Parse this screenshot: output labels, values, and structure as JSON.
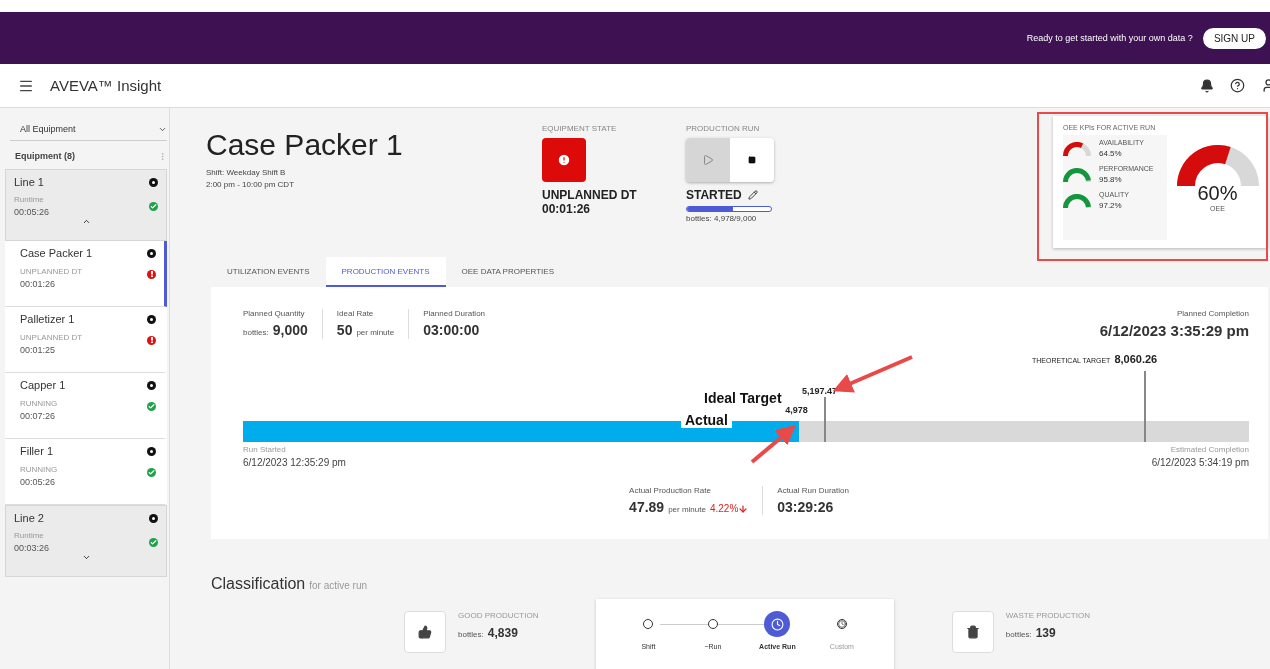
{
  "banner": {
    "prompt": "Ready to get started with your own data ?",
    "button": "SIGN UP"
  },
  "app_bar": {
    "title": "AVEVA™ Insight"
  },
  "sidebar": {
    "filter": "All Equipment",
    "heading": "Equipment (8)",
    "groups": [
      {
        "name": "Line 1",
        "state": "Runtime",
        "time": "00:05:26",
        "color": "#1fa34a",
        "expanded": true,
        "children": [
          {
            "name": "Case Packer 1",
            "state": "UNPLANNED DT",
            "time": "00:01:26",
            "color": "#e01010",
            "selected": true
          },
          {
            "name": "Palletizer 1",
            "state": "UNPLANNED DT",
            "time": "00:01:25",
            "color": "#e01010",
            "selected": false
          },
          {
            "name": "Capper 1",
            "state": "RUNNING",
            "time": "00:07:26",
            "color": "#1fa34a",
            "selected": false
          },
          {
            "name": "Filler 1",
            "state": "RUNNING",
            "time": "00:05:26",
            "color": "#1fa34a",
            "selected": false
          }
        ]
      },
      {
        "name": "Line 2",
        "state": "Runtime",
        "time": "00:03:26",
        "color": "#1fa34a",
        "expanded": false
      }
    ]
  },
  "equipment": {
    "name": "Case Packer 1",
    "shift": "Shift: Weekday Shift B",
    "hours": "2:00 pm - 10:00 pm CDT"
  },
  "equipment_state": {
    "label": "EQUIPMENT STATE",
    "state": "UNPLANNED DT",
    "time": "00:01:26",
    "color": "#dd0a0a"
  },
  "production_run": {
    "label": "PRODUCTION RUN",
    "status": "STARTED",
    "count": "bottles: 4,978/9,000",
    "level": 0.553
  },
  "oee": {
    "title": "OEE KPIs FOR ACTIVE RUN",
    "value": "60%",
    "label": "OEE",
    "color": "#d40c0c",
    "kpis": [
      {
        "name": "AVAILABILITY",
        "value": "64.5%",
        "color": "#d40c0c"
      },
      {
        "name": "PERFORMANCE",
        "value": "95.8%",
        "color": "#14963c"
      },
      {
        "name": "QUALITY",
        "value": "97.2%",
        "color": "#14963c"
      }
    ]
  },
  "tabs": [
    {
      "label": "UTILIZATION EVENTS",
      "selected": false
    },
    {
      "label": "PRODUCTION EVENTS",
      "selected": true
    },
    {
      "label": "OEE DATA PROPERTIES",
      "selected": false
    }
  ],
  "production": {
    "stats": [
      {
        "label": "Planned Quantity",
        "prefix": "bottles:",
        "value": "9,000"
      },
      {
        "label": "Ideal Rate",
        "value": "50",
        "suffix": "per minute"
      },
      {
        "label": "Planned Duration",
        "value": "03:00:00"
      }
    ],
    "planned_completion": {
      "label": "Planned Completion",
      "value": "6/12/2023 3:35:29 pm"
    },
    "theoretical_target": {
      "label": "THEORETICAL TARGET",
      "value": "8,060.26"
    },
    "ideal_target": "5,197.47",
    "actual": "4,978",
    "level": 0.553,
    "run_started": {
      "label": "Run Started",
      "value": "6/12/2023 12:35:29 pm"
    },
    "estimated_completion": {
      "label": "Estimated Completion",
      "value": "6/12/2023 5:34:19 pm"
    },
    "rate": {
      "label": "Actual Production Rate",
      "value": "47.89",
      "unit": "per minute",
      "change": "4.22%"
    },
    "duration": {
      "label": "Actual Run Duration",
      "value": "03:29:26"
    }
  },
  "annotations": {
    "ideal_target": "Ideal Target",
    "actual": "Actual"
  },
  "classification": {
    "title": "Classification",
    "subtitle": "for active run",
    "good": {
      "label": "GOOD PRODUCTION",
      "prefix": "bottles:",
      "value": "4,839"
    },
    "ranges": [
      {
        "label": "Shift",
        "selected": false,
        "disabled": false
      },
      {
        "label": "~Run",
        "selected": false,
        "disabled": false
      },
      {
        "label": "Active Run",
        "selected": true,
        "disabled": false
      },
      {
        "label": "Custom",
        "selected": false,
        "disabled": true
      }
    ],
    "waste": {
      "label": "WASTE PRODUCTION",
      "prefix": "bottles:",
      "value": "139"
    }
  }
}
